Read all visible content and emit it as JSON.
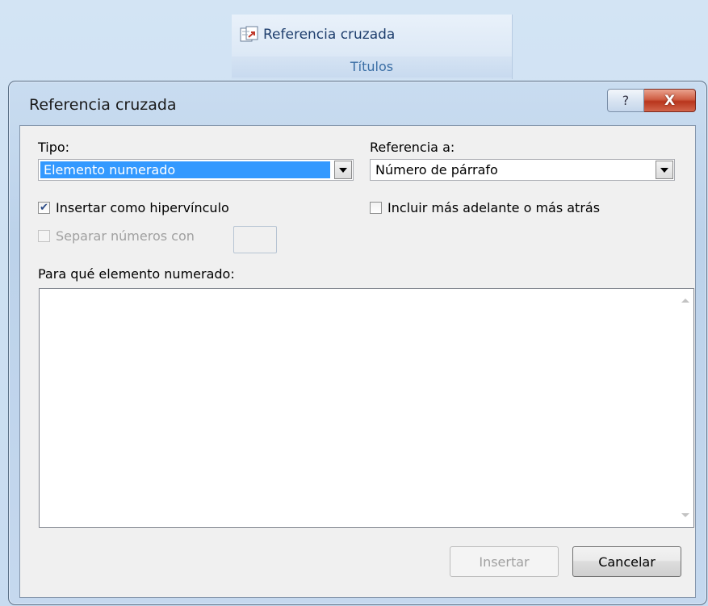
{
  "ribbon": {
    "button_label": "Referencia cruzada",
    "group_label": "Títulos",
    "button_icon": "cross-reference-icon"
  },
  "dialog": {
    "title": "Referencia cruzada",
    "help_symbol": "?",
    "close_symbol": "X",
    "tipo": {
      "label": "Tipo:",
      "value": "Elemento numerado"
    },
    "referencia": {
      "label": "Referencia a:",
      "value": "Número de párrafo"
    },
    "insertar_hipervinculo": {
      "label": "Insertar como hipervínculo",
      "checked": true
    },
    "incluir": {
      "label": "Incluir más adelante o más atrás",
      "checked": false
    },
    "separar": {
      "label": "Separar números con",
      "checked": false,
      "enabled": false,
      "value": ""
    },
    "para_que": {
      "label": "Para qué elemento numerado:",
      "items": []
    },
    "buttons": {
      "insertar": "Insertar",
      "cancelar": "Cancelar"
    }
  }
}
